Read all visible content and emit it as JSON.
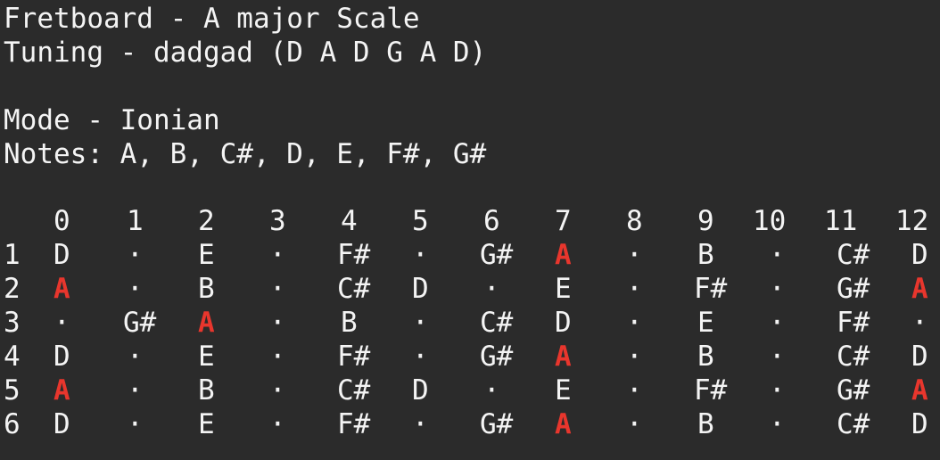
{
  "terminal": {
    "title_line": "Fretboard - A major Scale",
    "tuning_line": "Tuning - dadgad (D A D G A D)",
    "mode_line": "Mode - Ionian",
    "notes_line": "Notes: A, B, C#, D, E, F#, G#"
  },
  "fretboard": {
    "frets": [
      "0",
      "1",
      "2",
      "3",
      "4",
      "5",
      "6",
      "7",
      "8",
      "9",
      "10",
      "11",
      "12"
    ],
    "root_note": "A",
    "strings": [
      {
        "number": "1",
        "notes": [
          "D",
          "·",
          "E",
          "·",
          "F#",
          "·",
          "G#",
          "A",
          "·",
          "B",
          "·",
          "C#",
          "D"
        ]
      },
      {
        "number": "2",
        "notes": [
          "A",
          "·",
          "B",
          "·",
          "C#",
          "D",
          "·",
          "E",
          "·",
          "F#",
          "·",
          "G#",
          "A"
        ]
      },
      {
        "number": "3",
        "notes": [
          "·",
          "G#",
          "A",
          "·",
          "B",
          "·",
          "C#",
          "D",
          "·",
          "E",
          "·",
          "F#",
          "·"
        ]
      },
      {
        "number": "4",
        "notes": [
          "D",
          "·",
          "E",
          "·",
          "F#",
          "·",
          "G#",
          "A",
          "·",
          "B",
          "·",
          "C#",
          "D"
        ]
      },
      {
        "number": "5",
        "notes": [
          "A",
          "·",
          "B",
          "·",
          "C#",
          "D",
          "·",
          "E",
          "·",
          "F#",
          "·",
          "G#",
          "A"
        ]
      },
      {
        "number": "6",
        "notes": [
          "D",
          "·",
          "E",
          "·",
          "F#",
          "·",
          "G#",
          "A",
          "·",
          "B",
          "·",
          "C#",
          "D"
        ]
      }
    ],
    "colors": {
      "root": "#e8362d",
      "text": "#f4f4f4",
      "background": "#2b2b2b"
    }
  }
}
